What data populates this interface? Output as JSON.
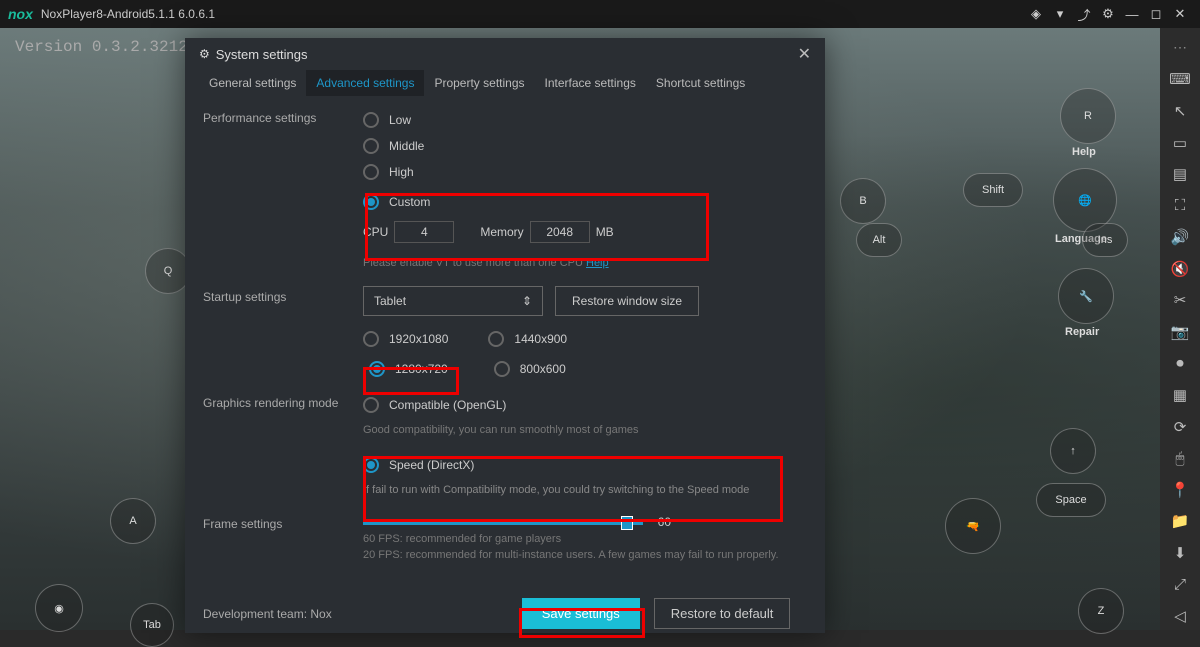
{
  "titlebar": {
    "app": "NoxPlayer8-Android5.1.1 6.0.6.1"
  },
  "version": "Version 0.3.2.3212",
  "game_keys": {
    "q": "Q",
    "a": "A",
    "tab": "Tab",
    "r": "R",
    "shift": "Shift",
    "alt": "Alt",
    "ins": "Ins",
    "space": "Space",
    "z": "Z",
    "help": "Help",
    "language": "Language",
    "repair": "Repair"
  },
  "dialog": {
    "title": "System settings",
    "tabs": [
      "General settings",
      "Advanced settings",
      "Property settings",
      "Interface settings",
      "Shortcut settings"
    ],
    "perf": {
      "label": "Performance settings",
      "low": "Low",
      "middle": "Middle",
      "high": "High",
      "custom": "Custom",
      "cpu_lbl": "CPU",
      "cpu": "4",
      "mem_lbl": "Memory",
      "mem": "2048",
      "mb": "MB",
      "hint": "Please enable VT to use more than one CPU ",
      "help": "Help"
    },
    "startup": {
      "label": "Startup settings",
      "device": "Tablet",
      "restore": "Restore window size",
      "r1": "1920x1080",
      "r2": "1440x900",
      "r3": "1280x720",
      "r4": "800x600"
    },
    "gfx": {
      "label": "Graphics rendering mode",
      "compat": "Compatible (OpenGL)",
      "compat_hint": "Good compatibility, you can run smoothly most of games",
      "speed": "Speed (DirectX)",
      "speed_hint": "If fail to run with Compatibility mode, you could try switching to the Speed mode"
    },
    "frame": {
      "label": "Frame settings",
      "val": "60",
      "hint": "60 FPS: recommended for game players\n20 FPS: recommended for multi-instance users. A few games may fail to run properly."
    },
    "dev": "Development team:  Nox",
    "save": "Save settings",
    "def": "Restore to default"
  }
}
